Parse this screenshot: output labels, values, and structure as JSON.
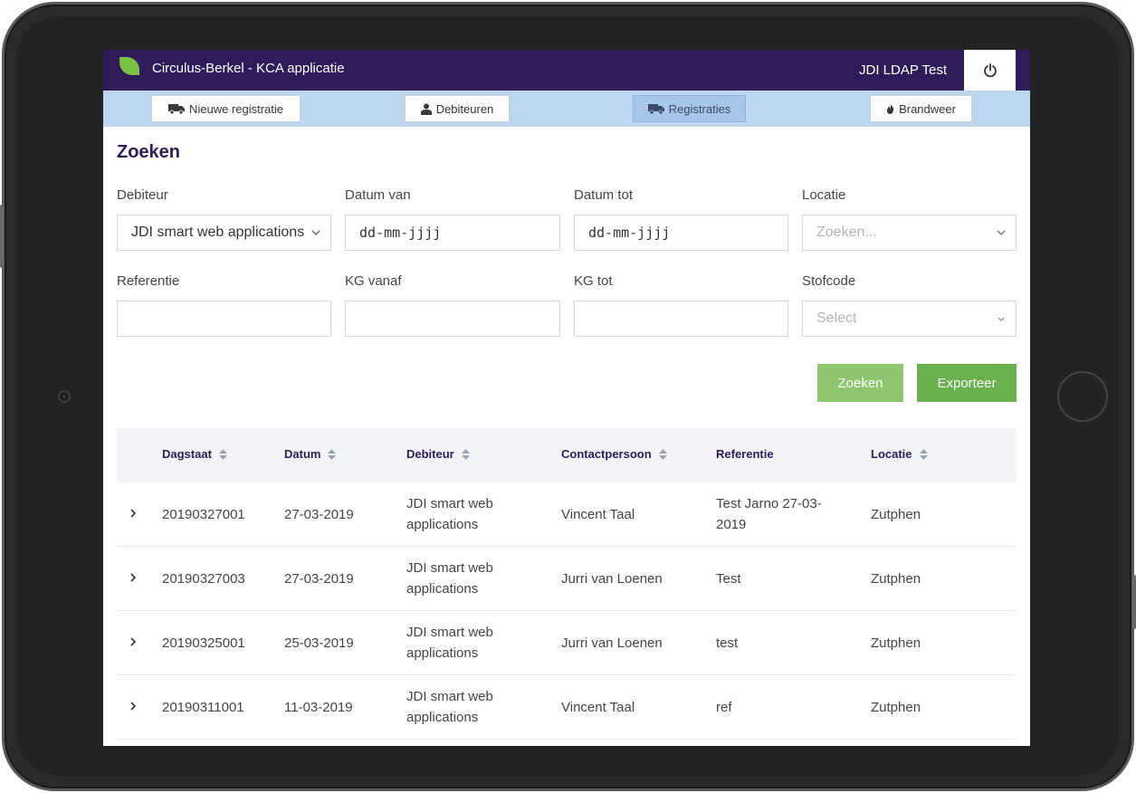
{
  "header": {
    "app_title": "Circulus-Berkel - KCA applicatie",
    "user": "JDI LDAP Test",
    "power_icon": "power-icon",
    "logo_color": "#7bc043",
    "bar_color": "#2e1b5a"
  },
  "nav": {
    "items": [
      {
        "label": "Nieuwe registratie",
        "icon": "truck-icon",
        "active": false
      },
      {
        "label": "Debiteuren",
        "icon": "user-icon",
        "active": false
      },
      {
        "label": "Registraties",
        "icon": "truck-icon",
        "active": true
      },
      {
        "label": "Brandweer",
        "icon": "fire-icon",
        "active": false
      }
    ]
  },
  "search": {
    "title": "Zoeken",
    "fields": {
      "debiteur": {
        "label": "Debiteur",
        "value": "JDI smart web applications"
      },
      "datum_van": {
        "label": "Datum van",
        "value": "dd-mm-jjjj"
      },
      "datum_tot": {
        "label": "Datum tot",
        "value": "dd-mm-jjjj"
      },
      "locatie": {
        "label": "Locatie",
        "placeholder": "Zoeken..."
      },
      "referentie": {
        "label": "Referentie",
        "value": ""
      },
      "kg_vanaf": {
        "label": "KG vanaf",
        "value": ""
      },
      "kg_tot": {
        "label": "KG tot",
        "value": ""
      },
      "stofcode": {
        "label": "Stofcode",
        "placeholder": "Select"
      }
    },
    "search_button": "Zoeken",
    "export_button": "Exporteer"
  },
  "table": {
    "columns": [
      "Dagstaat",
      "Datum",
      "Debiteur",
      "Contactpersoon",
      "Referentie",
      "Locatie"
    ],
    "rows": [
      {
        "dagstaat": "20190327001",
        "datum": "27-03-2019",
        "debiteur_1": "JDI smart web",
        "debiteur_2": "applications",
        "contact": "Vincent Taal",
        "ref_1": "Test Jarno 27-03-",
        "ref_2": "2019",
        "locatie": "Zutphen"
      },
      {
        "dagstaat": "20190327003",
        "datum": "27-03-2019",
        "debiteur_1": "JDI smart web",
        "debiteur_2": "applications",
        "contact": "Jurri van Loenen",
        "ref_1": "Test",
        "ref_2": "",
        "locatie": "Zutphen"
      },
      {
        "dagstaat": "20190325001",
        "datum": "25-03-2019",
        "debiteur_1": "JDI smart web",
        "debiteur_2": "applications",
        "contact": "Jurri van Loenen",
        "ref_1": "test",
        "ref_2": "",
        "locatie": "Zutphen"
      },
      {
        "dagstaat": "20190311001",
        "datum": "11-03-2019",
        "debiteur_1": "JDI smart web",
        "debiteur_2": "applications",
        "contact": "Vincent Taal",
        "ref_1": "ref",
        "ref_2": "",
        "locatie": "Zutphen"
      }
    ]
  }
}
